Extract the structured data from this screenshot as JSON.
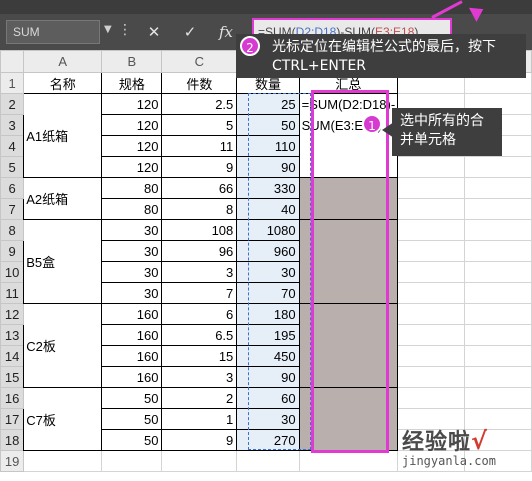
{
  "formula_bar": {
    "name_box": "SUM",
    "cancel_icon": "✕",
    "confirm_icon": "✓",
    "fx_label": "fx",
    "formula_prefix": "=SUM(",
    "formula_ref1": "D2:D18",
    "formula_mid": ")-SUM(",
    "formula_ref2": "E3:E18",
    "formula_suffix": ")"
  },
  "columns": [
    "A",
    "B",
    "C",
    "D",
    "E",
    "F",
    "G"
  ],
  "rows": [
    "1",
    "2",
    "3",
    "4",
    "5",
    "6",
    "7",
    "8",
    "9",
    "10",
    "11",
    "12",
    "13",
    "14",
    "15",
    "16",
    "17",
    "18",
    "19"
  ],
  "headers": {
    "name": "名称",
    "spec": "规格",
    "count": "件数",
    "qty": "数量",
    "total": "汇总"
  },
  "groups": [
    {
      "name": "A1纸箱",
      "rows": [
        {
          "spec": "120",
          "count": "2.5",
          "qty": "25"
        },
        {
          "spec": "120",
          "count": "5",
          "qty": "50"
        },
        {
          "spec": "120",
          "count": "11",
          "qty": "110"
        },
        {
          "spec": "120",
          "count": "9",
          "qty": "90"
        }
      ]
    },
    {
      "name": "A2纸箱",
      "rows": [
        {
          "spec": "80",
          "count": "66",
          "qty": "330"
        },
        {
          "spec": "80",
          "count": "8",
          "qty": "40"
        }
      ]
    },
    {
      "name": "B5盒",
      "rows": [
        {
          "spec": "30",
          "count": "108",
          "qty": "1080"
        },
        {
          "spec": "30",
          "count": "96",
          "qty": "960"
        },
        {
          "spec": "30",
          "count": "3",
          "qty": "30"
        },
        {
          "spec": "30",
          "count": "7",
          "qty": "70"
        }
      ]
    },
    {
      "name": "C2板",
      "rows": [
        {
          "spec": "160",
          "count": "6",
          "qty": "180"
        },
        {
          "spec": "160",
          "count": "6.5",
          "qty": "195"
        },
        {
          "spec": "160",
          "count": "15",
          "qty": "450"
        },
        {
          "spec": "160",
          "count": "3",
          "qty": "90"
        }
      ]
    },
    {
      "name": "C7板",
      "rows": [
        {
          "spec": "50",
          "count": "2",
          "qty": "60"
        },
        {
          "spec": "50",
          "count": "1",
          "qty": "30"
        },
        {
          "spec": "50",
          "count": "9",
          "qty": "270"
        }
      ]
    }
  ],
  "edit_cell_text": "=SUM(D2:D18)-SUM(E3:E18)",
  "annotations": {
    "step1_number": "1",
    "step1_text": "选中所有的合并单元格",
    "step2_number": "2",
    "step2_text": "光标定位在编辑栏公式的最后，按下CTRL+ENTER"
  },
  "watermark": {
    "title": "经验啦",
    "check": "√",
    "url": "jingyanla.com"
  },
  "colors": {
    "highlight": "#e13ad2",
    "merged_fill": "#b9b0ad",
    "selection_fill": "#e6eef8"
  }
}
